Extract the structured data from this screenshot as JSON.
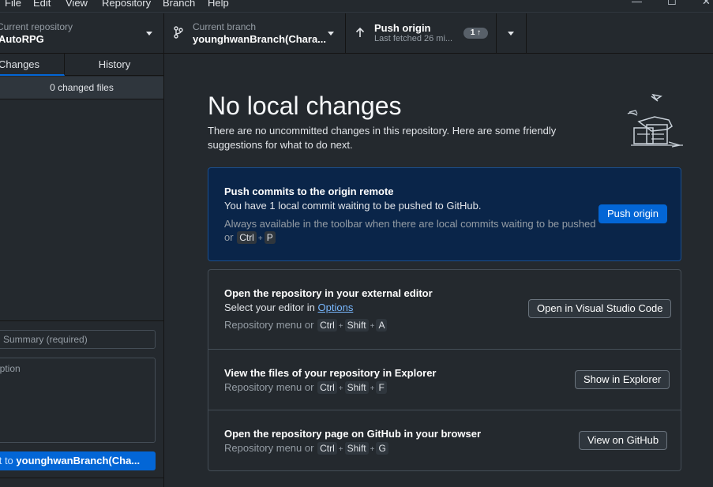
{
  "menu": {
    "file": "File",
    "edit": "Edit",
    "view": "View",
    "repository": "Repository",
    "branch": "Branch",
    "help": "Help"
  },
  "window": {
    "minimize": "—",
    "maximize": "☐",
    "close": "✕"
  },
  "toolbar": {
    "repo_label": "Current repository",
    "repo_value": "AutoRPG",
    "branch_label": "Current branch",
    "branch_value": "younghwanBranch(Chara...",
    "push_label": "Push origin",
    "push_sub": "Last fetched 26 mi...",
    "push_badge": "1 ↑"
  },
  "sidebar": {
    "tab_changes": "Changes",
    "tab_history": "History",
    "changed_files": "0 changed files",
    "summary_placeholder": "Summary (required)",
    "description_placeholder": "ription",
    "commit_prefix": "mit to ",
    "commit_branch": "younghwanBranch(Cha..."
  },
  "main": {
    "heading": "No local changes",
    "subtext": "There are no uncommitted changes in this repository. Here are some friendly suggestions for what to do next.",
    "push_card": {
      "title": "Push commits to the origin remote",
      "desc": "You have 1 local commit waiting to be pushed to GitHub.",
      "hint_line1": "Always available in the toolbar when there are local commits waiting to be pushed",
      "hint_or": "or",
      "key1": "Ctrl",
      "key2": "P",
      "button": "Push origin"
    },
    "editor_row": {
      "title": "Open the repository in your external editor",
      "desc_prefix": "Select your editor in ",
      "desc_link": "Options",
      "hint": "Repository menu or",
      "keys": [
        "Ctrl",
        "Shift",
        "A"
      ],
      "button": "Open in Visual Studio Code"
    },
    "explorer_row": {
      "title": "View the files of your repository in Explorer",
      "hint": "Repository menu or",
      "keys": [
        "Ctrl",
        "Shift",
        "F"
      ],
      "button": "Show in Explorer"
    },
    "github_row": {
      "title": "Open the repository page on GitHub in your browser",
      "hint": "Repository menu or",
      "keys": [
        "Ctrl",
        "Shift",
        "G"
      ],
      "button": "View on GitHub"
    }
  },
  "colors": {
    "background": "#24292e",
    "accent": "#0366d6",
    "push_card_bg": "#0a2549",
    "link": "#79b8ff"
  },
  "icons": {
    "branch": "git-branch-icon",
    "push": "arrow-up-icon",
    "dropdown": "triangle-down-icon"
  }
}
